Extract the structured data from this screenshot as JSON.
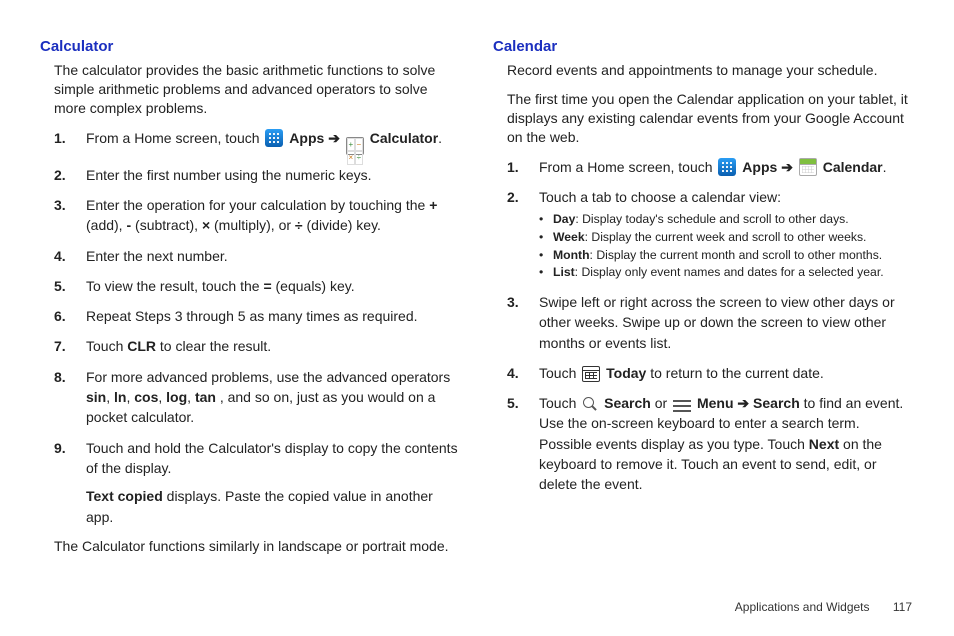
{
  "left": {
    "title": "Calculator",
    "intro": "The calculator provides the basic arithmetic functions to solve simple arithmetic problems and advanced operators to solve more complex problems.",
    "steps": {
      "s1_a": "From a Home screen, touch ",
      "s1_apps": " Apps ",
      "s1_arrow": "➔",
      "s1_calc": " Calculator",
      "s1_end": ".",
      "s2": "Enter the first number using the numeric keys.",
      "s3_a": "Enter the operation for your calculation by touching the ",
      "s3_plus": "+",
      "s3_add": " (add), ",
      "s3_minus": "-",
      "s3_sub": " (subtract), ",
      "s3_times": "×",
      "s3_mul": " (multiply), or ",
      "s3_div": "÷",
      "s3_divl": " (divide) key.",
      "s4": "Enter the next number.",
      "s5_a": "To view the result, touch the ",
      "s5_eq": "=",
      "s5_b": " (equals) key.",
      "s6": "Repeat Steps 3 through 5 as many times as required.",
      "s7_a": "Touch ",
      "s7_clr": "CLR",
      "s7_b": " to clear the result.",
      "s8_a": "For more advanced problems, use the advanced operators ",
      "s8_sin": "sin",
      "s8_c1": ", ",
      "s8_ln": "ln",
      "s8_c2": ", ",
      "s8_cos": "cos",
      "s8_c3": ", ",
      "s8_log": "log",
      "s8_c4": ", ",
      "s8_tan": "tan",
      "s8_b": ", and so on, just as you would on a pocket calculator.",
      "s9": "Touch and hold the Calculator's display to copy the contents of the display.",
      "s9n_a": "Text copied",
      "s9n_b": " displays. Paste the copied value in another app."
    },
    "outro": "The Calculator functions similarly in landscape or portrait mode."
  },
  "right": {
    "title": "Calendar",
    "intro1": "Record events and appointments to manage your schedule.",
    "intro2": "The first time you open the Calendar application on your tablet, it displays any existing calendar events from your Google Account on the web.",
    "steps": {
      "s1_a": "From a Home screen, touch ",
      "s1_apps": " Apps ",
      "s1_arrow": "➔",
      "s1_cal": " Calendar",
      "s1_end": ".",
      "s2": "Touch a tab to choose a calendar view:",
      "b_day_k": "Day",
      "b_day_v": ": Display today's schedule and scroll to other days.",
      "b_week_k": "Week",
      "b_week_v": ": Display the current week and scroll to other weeks.",
      "b_month_k": "Month",
      "b_month_v": ": Display the current month and scroll to other months.",
      "b_list_k": "List",
      "b_list_v": ": Display only event names and dates for a selected year.",
      "s3": "Swipe left or right across the screen to view other days or other weeks. Swipe up or down the screen to view other months or events list.",
      "s4_a": "Touch ",
      "s4_today": " Today",
      "s4_b": " to return to the current date.",
      "s5_a": "Touch ",
      "s5_search": " Search",
      "s5_or": " or ",
      "s5_menu": " Menu ",
      "s5_arrow": "➔",
      "s5_menusearch": " Search",
      "s5_b": " to find an event. Use the on-screen keyboard to enter a search term. Possible events display as you type. Touch ",
      "s5_next": "Next",
      "s5_c": " on the keyboard to remove it. Touch an event to send, edit, or delete the event."
    }
  },
  "footer": {
    "section": "Applications and Widgets",
    "page": "117"
  }
}
